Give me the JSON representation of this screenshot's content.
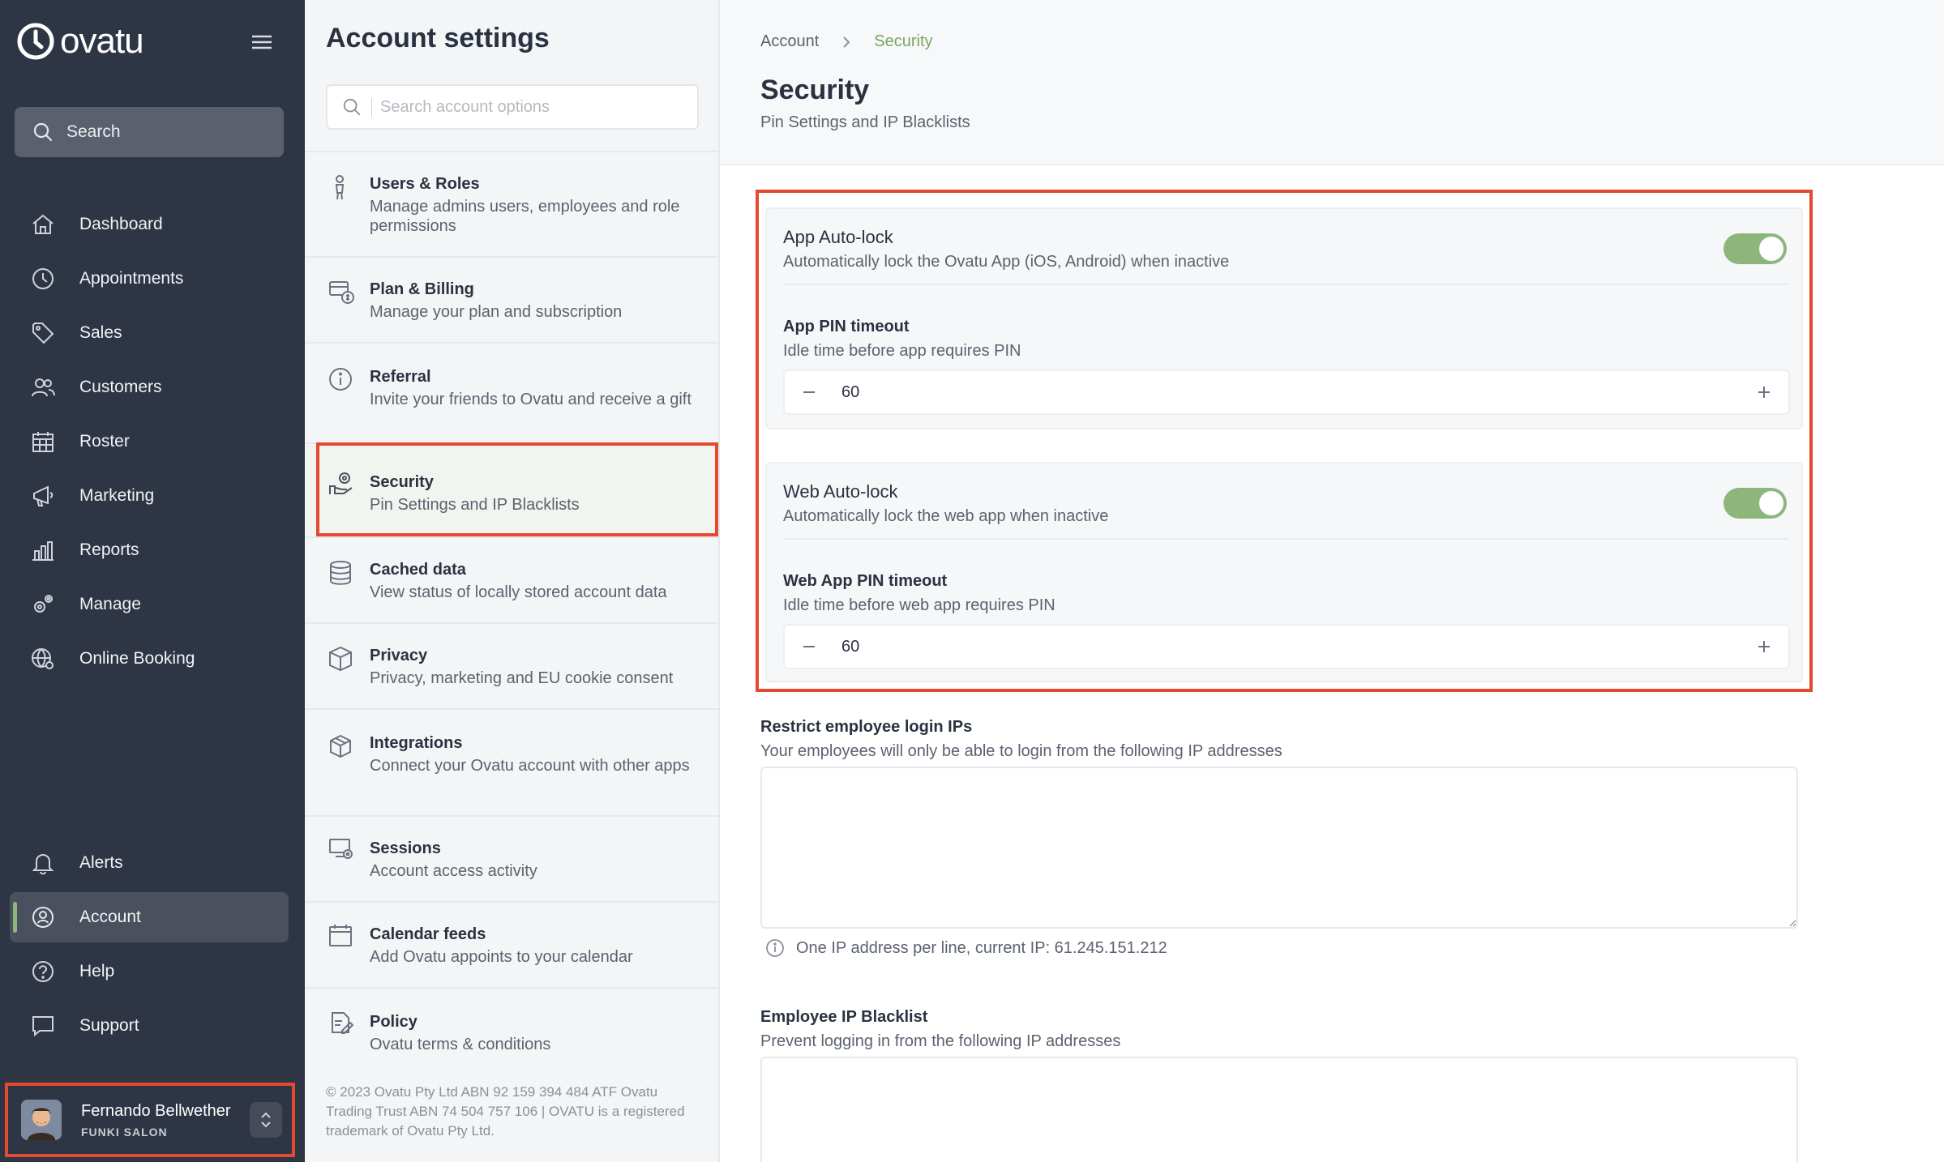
{
  "brand": {
    "name": "ovatu"
  },
  "sidebar": {
    "search_label": "Search",
    "nav": [
      {
        "label": "Dashboard",
        "icon": "home-icon"
      },
      {
        "label": "Appointments",
        "icon": "clock-icon"
      },
      {
        "label": "Sales",
        "icon": "tag-icon"
      },
      {
        "label": "Customers",
        "icon": "users-icon"
      },
      {
        "label": "Roster",
        "icon": "calendar-grid-icon"
      },
      {
        "label": "Marketing",
        "icon": "megaphone-icon"
      },
      {
        "label": "Reports",
        "icon": "bar-chart-icon"
      },
      {
        "label": "Manage",
        "icon": "gears-icon"
      },
      {
        "label": "Online Booking",
        "icon": "globe-gear-icon"
      }
    ],
    "bottom_nav": [
      {
        "label": "Alerts",
        "icon": "bell-icon"
      },
      {
        "label": "Account",
        "icon": "account-icon",
        "active": true
      },
      {
        "label": "Help",
        "icon": "help-icon"
      },
      {
        "label": "Support",
        "icon": "chat-icon"
      }
    ],
    "user": {
      "name": "Fernando Bellwether",
      "org": "FUNKI SALON"
    }
  },
  "settings": {
    "title": "Account settings",
    "search_placeholder": "Search account options",
    "items": [
      {
        "title": "Users & Roles",
        "desc": "Manage admins users, employees and role permissions",
        "icon": "user-icon"
      },
      {
        "title": "Plan & Billing",
        "desc": "Manage your plan and subscription",
        "icon": "billing-icon"
      },
      {
        "title": "Referral",
        "desc": "Invite your friends to Ovatu and receive a gift",
        "icon": "info-icon"
      },
      {
        "title": "Security",
        "desc": "Pin Settings and IP Blacklists",
        "icon": "security-icon",
        "active": true
      },
      {
        "title": "Cached data",
        "desc": "View status of locally stored account data",
        "icon": "database-icon"
      },
      {
        "title": "Privacy",
        "desc": "Privacy, marketing and EU cookie consent",
        "icon": "box-icon"
      },
      {
        "title": "Integrations",
        "desc": "Connect your Ovatu account with other apps",
        "icon": "cube-icon"
      },
      {
        "title": "Sessions",
        "desc": "Account access activity",
        "icon": "monitor-gear-icon"
      },
      {
        "title": "Calendar feeds",
        "desc": "Add Ovatu appoints to your calendar",
        "icon": "calendar-icon"
      },
      {
        "title": "Policy",
        "desc": "Ovatu terms & conditions",
        "icon": "policy-icon"
      }
    ],
    "footer": "© 2023 Ovatu Pty Ltd ABN 92 159 394 484 ATF Ovatu Trading Trust ABN 74 504 757 106 | OVATU is a registered trademark of Ovatu Pty Ltd."
  },
  "main": {
    "breadcrumb": {
      "account": "Account",
      "current": "Security"
    },
    "title": "Security",
    "subtitle": "Pin Settings and IP Blacklists",
    "app_lock": {
      "title": "App Auto-lock",
      "desc": "Automatically lock the Ovatu App (iOS, Android) when inactive",
      "enabled": true,
      "timeout_label": "App PIN timeout",
      "timeout_desc": "Idle time before app requires PIN",
      "timeout_value": "60"
    },
    "web_lock": {
      "title": "Web Auto-lock",
      "desc": "Automatically lock the web app when inactive",
      "enabled": true,
      "timeout_label": "Web App PIN timeout",
      "timeout_desc": "Idle time before web app requires PIN",
      "timeout_value": "60"
    },
    "restrict_ips": {
      "label": "Restrict employee login IPs",
      "desc": "Your employees will only be able to login from the following IP addresses",
      "value": "",
      "hint": "One IP address per line, current IP: 61.245.151.212"
    },
    "blacklist": {
      "label": "Employee IP Blacklist",
      "desc": "Prevent logging in from the following IP addresses",
      "value": ""
    }
  },
  "colors": {
    "accent": "#8fb67a",
    "sidebar": "#2e3544",
    "highlight": "#e34a2f"
  }
}
